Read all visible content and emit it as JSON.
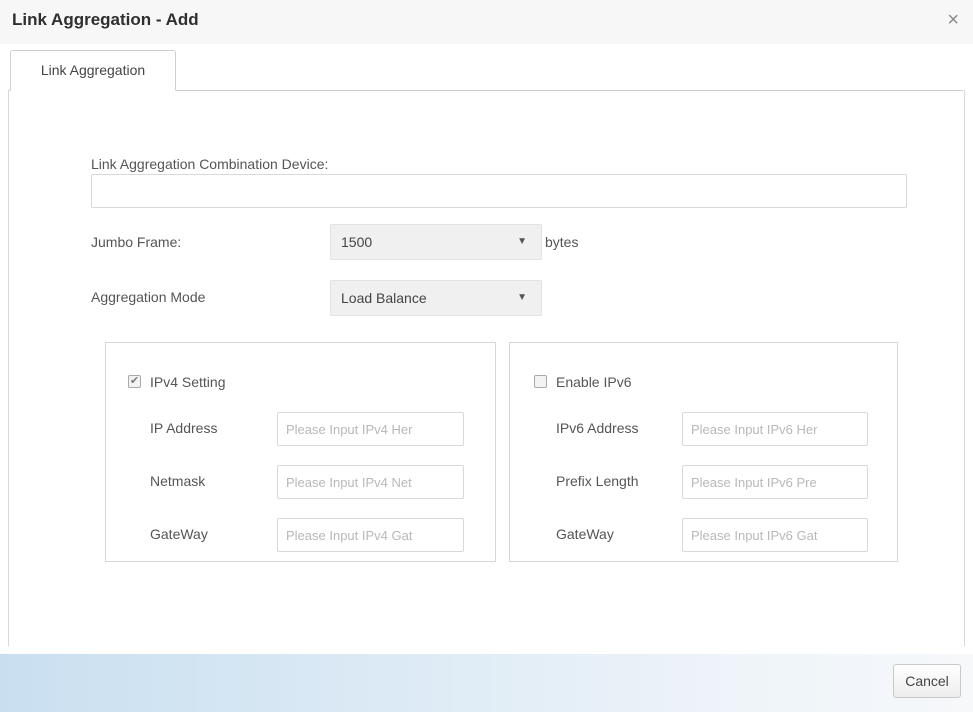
{
  "dialog": {
    "title": "Link Aggregation - Add",
    "close_symbol": "×"
  },
  "tabs": [
    {
      "label": "Link Aggregation",
      "active": true
    }
  ],
  "form": {
    "combination_device": {
      "label": "Link Aggregation Combination Device:",
      "value": ""
    },
    "jumbo_frame": {
      "label": "Jumbo Frame:",
      "value": "1500",
      "unit": "bytes"
    },
    "aggregation_mode": {
      "label": "Aggregation Mode",
      "value": "Load Balance"
    },
    "ipv4": {
      "checkbox_label": "IPv4 Setting",
      "checked": true,
      "fields": [
        {
          "label": "IP Address",
          "placeholder": "Please Input IPv4 Her",
          "value": ""
        },
        {
          "label": "Netmask",
          "placeholder": "Please Input IPv4 Net",
          "value": ""
        },
        {
          "label": "GateWay",
          "placeholder": "Please Input IPv4 Gat",
          "value": ""
        }
      ]
    },
    "ipv6": {
      "checkbox_label": "Enable IPv6",
      "checked": false,
      "fields": [
        {
          "label": "IPv6 Address",
          "placeholder": "Please Input IPv6 Her",
          "value": ""
        },
        {
          "label": "Prefix Length",
          "placeholder": "Please Input IPv6 Pre",
          "value": ""
        },
        {
          "label": "GateWay",
          "placeholder": "Please Input IPv6 Gat",
          "value": ""
        }
      ]
    }
  },
  "footer": {
    "cancel_label": "Cancel"
  },
  "icons": {
    "dropdown": "chevron-down-icon",
    "check": "checkmark-icon",
    "close": "close-icon"
  }
}
